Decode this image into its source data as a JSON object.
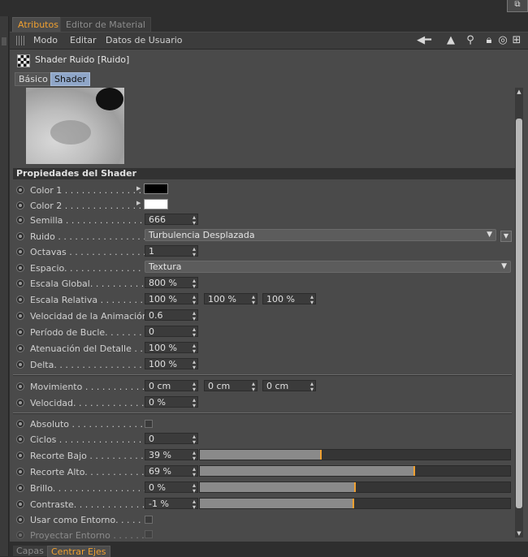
{
  "tabs": {
    "attributes": "Atributos",
    "material_editor": "Editor de Material"
  },
  "menu": {
    "mode": "Modo",
    "edit": "Editar",
    "user_data": "Datos de Usuario"
  },
  "shader_title": "Shader Ruido [Ruido]",
  "subtabs": {
    "basic": "Básico",
    "shader": "Shader"
  },
  "section_title": "Propiedades del Shader",
  "labels": {
    "color1": "Color 1 . . . . . . . . . . . . . .",
    "color2": "Color 2 . . . . . . . . . . . . . .",
    "seed": "Semilla . . . . . . . . . . . . . . .",
    "noise": "Ruido . . . . . . . . . . . . . . . .",
    "octaves": "Octavas . . . . . . . . . . . . . .",
    "space": "Espacio. . . . . . . . . . . . . . .",
    "global_scale": "Escala Global. . . . . . . . . . .",
    "relative_scale": "Escala Relativa . . . . . . . . .",
    "anim_speed": "Velocidad de la Animación",
    "loop_period": "Período de Bucle. . . . . . . .",
    "detail_atten": "Atenuación del Detalle . . .",
    "delta": "Delta. . . . . . . . . . . . . . . . .",
    "movement": "Movimiento . . . . . . . . . . . .",
    "speed": "Velocidad. . . . . . . . . . . . . .",
    "absolute": "Absoluto . . . . . . . . . . . . . .",
    "cycles": "Ciclos . . . . . . . . . . . . . . . .",
    "low_clip": "Recorte Bajo . . . . . . . . . . .",
    "high_clip": "Recorte Alto. . . . . . . . . . . .",
    "brightness": "Brillo. . . . . . . . . . . . . . . . .",
    "contrast": "Contraste. . . . . . . . . . . . . .",
    "use_env": "Usar como Entorno. . . . . .",
    "project_env": "Proyectar Entorno . . . . . ."
  },
  "values": {
    "seed": "666",
    "noise": "Turbulencia Desplazada",
    "octaves": "1",
    "space": "Textura",
    "global_scale": "800 %",
    "relative_scale": [
      "100 %",
      "100 %",
      "100 %"
    ],
    "anim_speed": "0.6",
    "loop_period": "0",
    "detail_atten": "100 %",
    "delta": "100 %",
    "movement": [
      "0 cm",
      "0 cm",
      "0 cm"
    ],
    "speed": "0 %",
    "cycles": "0",
    "low_clip": "39 %",
    "high_clip": "69 %",
    "brightness": "0 %",
    "contrast": "-1 %"
  },
  "sliders": {
    "low_clip": 0.39,
    "high_clip": 0.69,
    "brightness": 0.5,
    "contrast": 0.495
  },
  "colors": {
    "color1": "#000000",
    "color2": "#ffffff",
    "accent": "#f0a030"
  },
  "bottom_tabs": {
    "layers": "Capas",
    "center_axes": "Centrar Ejes"
  }
}
